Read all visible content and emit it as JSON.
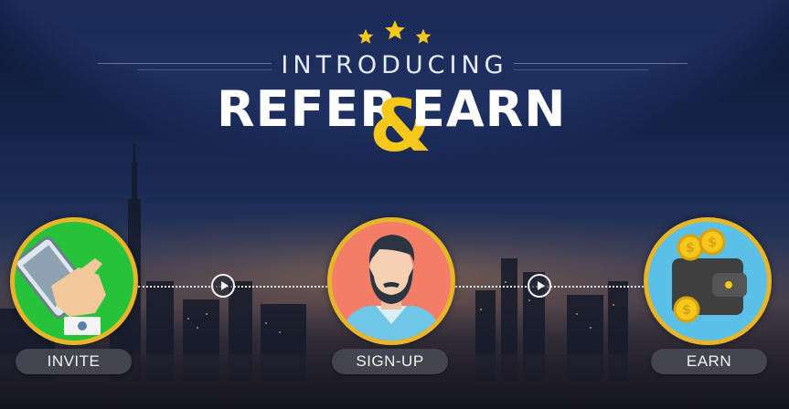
{
  "header": {
    "stars": [
      "star-icon",
      "star-icon",
      "star-icon"
    ],
    "intro": "INTRODUCING",
    "title_left": "REFER",
    "title_amp": "&",
    "title_right": "EARN"
  },
  "steps": [
    {
      "label": "INVITE",
      "icon": "phone-hand-icon"
    },
    {
      "label": "SIGN-UP",
      "icon": "user-avatar-icon"
    },
    {
      "label": "EARN",
      "icon": "wallet-coins-icon"
    }
  ],
  "colors": {
    "accent_gold": "#f7c81c",
    "invite_bg": "#25c23a",
    "signup_bg": "#f47d68",
    "earn_bg": "#5bc0e8"
  }
}
